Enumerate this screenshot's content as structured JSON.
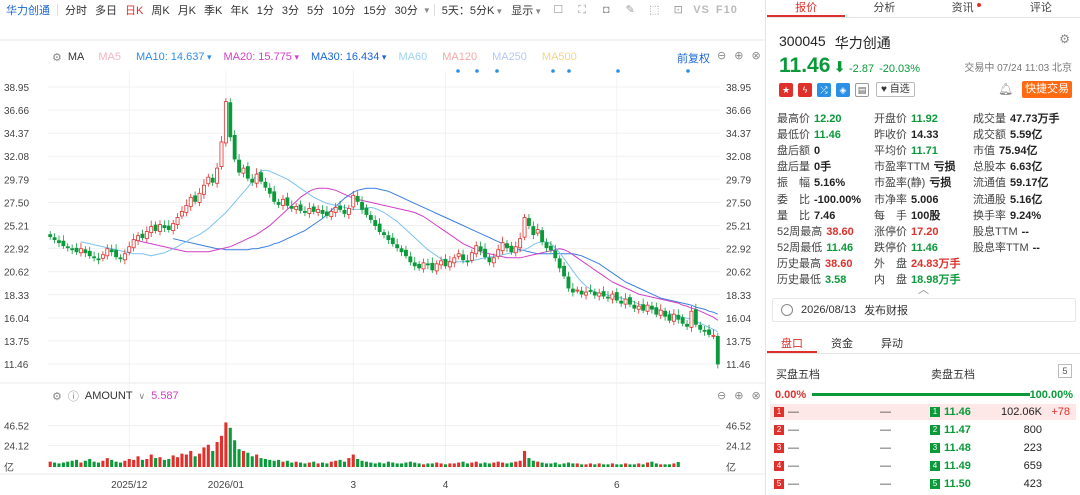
{
  "toolbar": {
    "stock_name": "华力创通",
    "items": [
      "分时",
      "多日",
      "日K",
      "周K",
      "月K",
      "季K",
      "年K",
      "1分",
      "3分",
      "5分",
      "10分",
      "15分",
      "30分"
    ],
    "active_item": "日K",
    "range_select": "5天：5分K",
    "display_select": "显示",
    "vs_label": "VS",
    "f10_label": "F10"
  },
  "ma_legend": {
    "label": "MA",
    "items": [
      {
        "name": "MA5",
        "value": "",
        "color": "#f5b5c4"
      },
      {
        "name": "MA10:",
        "value": "14.637",
        "color": "#2b8fe6"
      },
      {
        "name": "MA20:",
        "value": "15.775",
        "color": "#d23fc6"
      },
      {
        "name": "MA30:",
        "value": "16.434",
        "color": "#1a66d6"
      },
      {
        "name": "MA60",
        "value": "",
        "color": "#9fd3f2"
      },
      {
        "name": "MA120",
        "value": "",
        "color": "#f5a7a7"
      },
      {
        "name": "MA250",
        "value": "",
        "color": "#b4c8f5"
      },
      {
        "name": "MA500",
        "value": "",
        "color": "#f7d58a"
      }
    ],
    "fq_label": "前复权"
  },
  "amount_legend": {
    "label": "AMOUNT",
    "value": "5.587"
  },
  "chart_data": [
    {
      "type": "candlestick",
      "y_ticks": [
        "38.95",
        "36.66",
        "34.37",
        "32.08",
        "29.79",
        "27.50",
        "25.21",
        "22.92",
        "20.62",
        "18.33",
        "16.04",
        "13.75",
        "11.46"
      ],
      "ylim": [
        11.46,
        38.95
      ],
      "x_labels": [
        {
          "label": "2025/12",
          "index": 18
        },
        {
          "label": "2026/01",
          "index": 40
        },
        {
          "label": "3",
          "index": 69
        },
        {
          "label": "4",
          "index": 90
        },
        {
          "label": "6",
          "index": 129
        }
      ],
      "close": [
        24.1,
        23.8,
        23.5,
        23.2,
        23.0,
        22.8,
        22.6,
        22.9,
        22.5,
        22.2,
        22.0,
        21.8,
        22.3,
        22.9,
        22.6,
        22.1,
        21.9,
        22.4,
        23.1,
        23.8,
        24.2,
        24.0,
        24.6,
        25.1,
        24.7,
        25.3,
        25.0,
        24.8,
        25.4,
        26.0,
        26.6,
        27.2,
        28.0,
        27.6,
        28.4,
        29.2,
        30.0,
        29.5,
        30.9,
        33.5,
        37.5,
        34.0,
        31.8,
        30.5,
        30.9,
        29.9,
        29.5,
        30.3,
        29.6,
        29.0,
        28.4,
        27.6,
        27.3,
        27.8,
        27.2,
        26.9,
        27.1,
        26.7,
        26.5,
        26.9,
        26.6,
        26.8,
        26.4,
        26.2,
        26.6,
        27.0,
        26.8,
        26.4,
        26.9,
        28.2,
        27.6,
        26.8,
        26.3,
        25.8,
        25.2,
        24.6,
        24.3,
        23.8,
        23.4,
        23.0,
        22.6,
        22.2,
        21.6,
        21.2,
        21.0,
        21.5,
        21.3,
        20.8,
        21.4,
        21.7,
        21.2,
        21.6,
        22.0,
        22.4,
        21.8,
        21.6,
        22.5,
        23.2,
        22.7,
        22.1,
        21.6,
        22.0,
        22.8,
        23.5,
        23.0,
        22.6,
        23.1,
        23.9,
        26.0,
        25.2,
        24.3,
        24.8,
        23.6,
        23.0,
        22.8,
        22.0,
        21.0,
        20.2,
        19.0,
        18.6,
        18.8,
        18.4,
        18.6,
        18.7,
        18.3,
        18.5,
        18.2,
        18.0,
        18.4,
        17.8,
        17.5,
        17.9,
        17.4,
        17.0,
        17.2,
        16.8,
        17.3,
        16.9,
        16.4,
        16.8,
        16.2,
        15.8,
        16.4,
        15.9,
        15.5,
        15.2,
        16.7,
        15.4,
        14.9,
        14.7,
        14.4,
        14.3,
        11.46
      ],
      "ma10": [
        23.6,
        23.5,
        23.4,
        23.3,
        23.2,
        23.1,
        23.0,
        22.9,
        22.8,
        22.7,
        22.6,
        22.5,
        22.4,
        22.4,
        22.4,
        22.3,
        22.2,
        22.3,
        22.4,
        22.5,
        22.7,
        22.9,
        23.1,
        23.4,
        23.6,
        23.9,
        24.1,
        24.3,
        24.6,
        24.9,
        25.3,
        25.7,
        26.1,
        26.5,
        27.0,
        27.5,
        28.0,
        28.5,
        29.0,
        29.6,
        30.3,
        30.6,
        30.7,
        30.6,
        30.4,
        30.2,
        30.0,
        29.8,
        29.5,
        29.2,
        28.9,
        28.6,
        28.3,
        28.0,
        27.8,
        27.6,
        27.4,
        27.3,
        27.2,
        27.1,
        27.0,
        26.9,
        26.8,
        26.8,
        26.8,
        26.9,
        27.0,
        26.9,
        26.7,
        26.5,
        26.2,
        25.9,
        25.6,
        25.2,
        24.8,
        24.4,
        24.0,
        23.6,
        23.2,
        22.8,
        22.5,
        22.2,
        21.9,
        21.7,
        21.6,
        21.6,
        21.6,
        21.6,
        21.6,
        21.7,
        21.8,
        21.9,
        22.0,
        22.1,
        22.1,
        22.2,
        22.3,
        22.4,
        22.5,
        22.6,
        22.7,
        22.8,
        23.0,
        23.3,
        23.5,
        23.6,
        23.6,
        23.4,
        23.0,
        22.5,
        21.9,
        21.3,
        20.7,
        20.1,
        19.6,
        19.2,
        18.9,
        18.6,
        18.5,
        18.4,
        18.3,
        18.2,
        18.1,
        18.0,
        17.9,
        17.8,
        17.6,
        17.4,
        17.3,
        17.1,
        17.0,
        16.9,
        16.8,
        16.6,
        16.5,
        16.3,
        16.2,
        16.1,
        16.0,
        15.9,
        15.7,
        15.5,
        15.3,
        15.1,
        14.9,
        14.64
      ],
      "ma20": [
        23.8,
        23.7,
        23.6,
        23.5,
        23.4,
        23.3,
        23.2,
        23.1,
        23.0,
        22.9,
        22.8,
        22.7,
        22.6,
        22.6,
        22.6,
        22.6,
        22.6,
        22.6,
        22.7,
        22.8,
        22.9,
        23.0,
        23.1,
        23.3,
        23.5,
        23.7,
        23.9,
        24.1,
        24.3,
        24.6,
        24.9,
        25.2,
        25.6,
        26.0,
        26.4,
        26.8,
        27.2,
        27.6,
        28.0,
        28.3,
        28.6,
        28.8,
        28.9,
        28.9,
        28.9,
        28.8,
        28.7,
        28.5,
        28.3,
        28.1,
        27.9,
        27.8,
        27.7,
        27.6,
        27.5,
        27.4,
        27.3,
        27.2,
        27.1,
        27.0,
        26.9,
        26.8,
        26.7,
        26.6,
        26.5,
        26.3,
        26.1,
        25.8,
        25.5,
        25.2,
        24.9,
        24.6,
        24.3,
        24.0,
        23.7,
        23.4,
        23.2,
        23.0,
        22.8,
        22.6,
        22.5,
        22.4,
        22.3,
        22.2,
        22.1,
        22.0,
        22.0,
        22.0,
        22.0,
        22.1,
        22.2,
        22.3,
        22.4,
        22.5,
        22.6,
        22.7,
        22.8,
        22.9,
        22.8,
        22.6,
        22.3,
        22.0,
        21.7,
        21.4,
        21.1,
        20.8,
        20.5,
        20.2,
        19.9,
        19.6,
        19.4,
        19.2,
        19.0,
        18.8,
        18.6,
        18.4,
        18.3,
        18.2,
        18.1,
        18.0,
        17.9,
        17.8,
        17.7,
        17.6,
        17.5,
        17.3,
        17.2,
        17.0,
        16.9,
        16.7,
        16.5,
        16.3,
        16.1,
        15.8
      ],
      "ma30": [
        23.9,
        23.8,
        23.7,
        23.6,
        23.5,
        23.4,
        23.3,
        23.2,
        23.1,
        23.0,
        22.9,
        22.9,
        22.8,
        22.8,
        22.8,
        22.8,
        22.8,
        22.8,
        22.9,
        22.9,
        23.0,
        23.1,
        23.2,
        23.4,
        23.5,
        23.7,
        23.9,
        24.1,
        24.3,
        24.5,
        24.7,
        25.0,
        25.3,
        25.6,
        25.9,
        26.3,
        26.7,
        27.1,
        27.5,
        27.9,
        28.2,
        28.5,
        28.7,
        28.8,
        28.9,
        28.9,
        28.9,
        28.8,
        28.7,
        28.6,
        28.4,
        28.2,
        28.0,
        27.8,
        27.6,
        27.4,
        27.2,
        27.0,
        26.8,
        26.6,
        26.4,
        26.2,
        26.0,
        25.8,
        25.6,
        25.4,
        25.2,
        25.0,
        24.8,
        24.6,
        24.4,
        24.2,
        24.0,
        23.8,
        23.6,
        23.4,
        23.2,
        23.0,
        22.9,
        22.8,
        22.7,
        22.6,
        22.5,
        22.4,
        22.4,
        22.4,
        22.4,
        22.4,
        22.4,
        22.4,
        22.4,
        22.4,
        22.3,
        22.2,
        22.0,
        21.8,
        21.6,
        21.4,
        21.1,
        20.8,
        20.5,
        20.2,
        19.9,
        19.6,
        19.4,
        19.2,
        19.0,
        18.8,
        18.6,
        18.4,
        18.2,
        18.0,
        17.9,
        17.8,
        17.7,
        17.6,
        17.5,
        17.4,
        17.3,
        17.1,
        17.0,
        16.9,
        16.7,
        16.6,
        16.4
      ]
    },
    {
      "type": "bar",
      "title": "AMOUNT",
      "y_ticks": [
        "46.52",
        "24.12",
        "亿"
      ],
      "ylim": [
        0,
        55
      ],
      "values": [
        6,
        5,
        4,
        5,
        6,
        7,
        8,
        5,
        7,
        9,
        6,
        5,
        7,
        10,
        8,
        6,
        5,
        7,
        9,
        8,
        12,
        8,
        9,
        14,
        10,
        11,
        8,
        9,
        13,
        11,
        15,
        14,
        18,
        12,
        15,
        22,
        25,
        18,
        28,
        35,
        50,
        44,
        30,
        20,
        18,
        16,
        12,
        14,
        10,
        9,
        8,
        7,
        8,
        6,
        7,
        5,
        6,
        5,
        4,
        5,
        6,
        4,
        5,
        4,
        6,
        7,
        8,
        6,
        10,
        14,
        9,
        7,
        6,
        5,
        4,
        5,
        4,
        6,
        5,
        4,
        4,
        5,
        6,
        5,
        4,
        3,
        4,
        4,
        5,
        4,
        3,
        4,
        4,
        5,
        6,
        4,
        5,
        6,
        4,
        5,
        4,
        5,
        6,
        5,
        4,
        5,
        6,
        7,
        18,
        10,
        7,
        6,
        5,
        4,
        4,
        5,
        3,
        4,
        5,
        4,
        4,
        3,
        3,
        4,
        3,
        4,
        3,
        3,
        4,
        3,
        3,
        4,
        3,
        3,
        4,
        3,
        5,
        6,
        4,
        3,
        3,
        3,
        4,
        5.587
      ]
    }
  ],
  "right_tabs": [
    "报价",
    "分析",
    "资讯",
    "评论"
  ],
  "quote": {
    "code": "300045",
    "name": "华力创通",
    "price": "11.46",
    "arrow": "⬇",
    "change": "-2.87",
    "change_pct": "-20.03%",
    "trade_time": "交易中 07/24 11:03 北京",
    "zixuan_label": "自选",
    "quick_trade_label": "快捷交易"
  },
  "stats": [
    {
      "k": "最高价",
      "v": "12.20",
      "c": "c-green"
    },
    {
      "k": "开盘价",
      "v": "11.92",
      "c": "c-green"
    },
    {
      "k": "成交量",
      "v": "47.73万手",
      "c": "c-dark"
    },
    {
      "k": "最低价",
      "v": "11.46",
      "c": "c-green"
    },
    {
      "k": "昨收价",
      "v": "14.33",
      "c": "c-dark"
    },
    {
      "k": "成交额",
      "v": "5.59亿",
      "c": "c-dark"
    },
    {
      "k": "盘后额",
      "v": "0",
      "c": "c-dark"
    },
    {
      "k": "平均价",
      "v": "11.71",
      "c": "c-green"
    },
    {
      "k": "市值",
      "v": "75.94亿",
      "c": "c-dark"
    },
    {
      "k": "盘后量",
      "v": "0手",
      "c": "c-dark"
    },
    {
      "k": "市盈率TTM",
      "v": "亏损",
      "c": "c-dark"
    },
    {
      "k": "总股本",
      "v": "6.63亿",
      "c": "c-dark"
    },
    {
      "k": "振　幅",
      "v": "5.16%",
      "c": "c-dark"
    },
    {
      "k": "市盈率(静)",
      "v": "亏损",
      "c": "c-dark"
    },
    {
      "k": "流通值",
      "v": "59.17亿",
      "c": "c-dark"
    },
    {
      "k": "委　比",
      "v": "-100.00%",
      "c": "c-dark"
    },
    {
      "k": "市净率",
      "v": "5.006",
      "c": "c-dark"
    },
    {
      "k": "流通股",
      "v": "5.16亿",
      "c": "c-dark"
    },
    {
      "k": "量　比",
      "v": "7.46",
      "c": "c-dark"
    },
    {
      "k": "每　手",
      "v": "100股",
      "c": "c-dark"
    },
    {
      "k": "换手率",
      "v": "9.24%",
      "c": "c-dark"
    },
    {
      "k": "52周最高",
      "v": "38.60",
      "c": "c-red"
    },
    {
      "k": "涨停价",
      "v": "17.20",
      "c": "c-red"
    },
    {
      "k": "股息TTM",
      "v": "--",
      "c": "c-dark"
    },
    {
      "k": "52周最低",
      "v": "11.46",
      "c": "c-green"
    },
    {
      "k": "跌停价",
      "v": "11.46",
      "c": "c-green"
    },
    {
      "k": "股息率TTM",
      "v": "--",
      "c": "c-dark"
    },
    {
      "k": "历史最高",
      "v": "38.60",
      "c": "c-red"
    },
    {
      "k": "外　盘",
      "v": "24.83万手",
      "c": "c-red"
    },
    {
      "k": "",
      "v": "",
      "c": "c-dark"
    },
    {
      "k": "历史最低",
      "v": "3.58",
      "c": "c-green"
    },
    {
      "k": "内　盘",
      "v": "18.98万手",
      "c": "c-green"
    },
    {
      "k": "",
      "v": "",
      "c": "c-dark"
    }
  ],
  "report": {
    "date": "2026/08/13",
    "label": "发布财报"
  },
  "panel_tabs": [
    "盘口",
    "资金",
    "异动"
  ],
  "book": {
    "buy_label": "买盘五档",
    "sell_label": "卖盘五档",
    "five": "5",
    "buy_pct": "0.00%",
    "sell_pct": "100.00%",
    "rows": [
      {
        "n": "1",
        "bq": "—",
        "bv": "—",
        "sn": "1",
        "sp": "11.46",
        "sv": "102.06K",
        "sd": "+78"
      },
      {
        "n": "2",
        "bq": "—",
        "bv": "—",
        "sn": "2",
        "sp": "11.47",
        "sv": "800",
        "sd": ""
      },
      {
        "n": "3",
        "bq": "—",
        "bv": "—",
        "sn": "3",
        "sp": "11.48",
        "sv": "223",
        "sd": ""
      },
      {
        "n": "4",
        "bq": "—",
        "bv": "—",
        "sn": "4",
        "sp": "11.49",
        "sv": "659",
        "sd": ""
      },
      {
        "n": "5",
        "bq": "—",
        "bv": "—",
        "sn": "5",
        "sp": "11.50",
        "sv": "423",
        "sd": ""
      }
    ]
  },
  "colors": {
    "up": "#e0302b",
    "down": "#0a9a3a",
    "accent": "#1a66d6",
    "orange": "#ff6a13"
  }
}
